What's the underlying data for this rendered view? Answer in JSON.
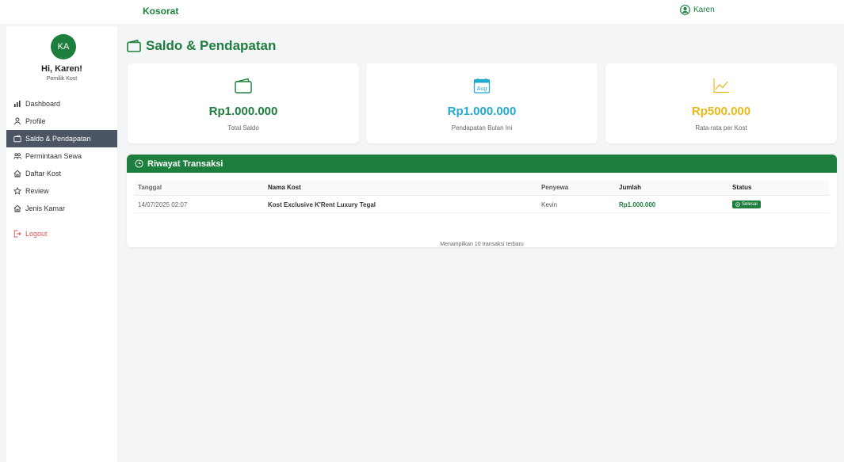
{
  "topbar": {
    "brand": "Kosorat",
    "user_name": "Karen"
  },
  "sidebar": {
    "avatar_initials": "KA",
    "greeting": "Hi, Karen!",
    "role": "Pemilik Kost",
    "items": [
      {
        "label": "Dashboard",
        "icon": "chart-icon"
      },
      {
        "label": "Profile",
        "icon": "person-icon"
      },
      {
        "label": "Saldo & Pendapatan",
        "icon": "wallet-icon",
        "active": true
      },
      {
        "label": "Permintaan Sewa",
        "icon": "people-icon"
      },
      {
        "label": "Daftar Kost",
        "icon": "house-icon"
      },
      {
        "label": "Review",
        "icon": "star-icon"
      },
      {
        "label": "Jenis Kamar",
        "icon": "house-icon"
      }
    ],
    "logout_label": "Logout"
  },
  "main": {
    "title": "Saldo & Pendapatan",
    "cards": [
      {
        "value": "Rp1.000.000",
        "caption": "Total Saldo",
        "icon": "wallet-icon",
        "color": "#1e7e3e"
      },
      {
        "value": "Rp1.000.000",
        "caption": "Pendapatan Bulan Ini",
        "icon": "calendar-icon",
        "icon_text": "Aug",
        "color": "#22aacc"
      },
      {
        "value": "Rp500.000",
        "caption": "Rata-rata per Kost",
        "icon": "trend-icon",
        "color": "#e8b81a"
      }
    ],
    "transactions": {
      "title": "Riwayat Transaksi",
      "columns": [
        "Tanggal",
        "Nama Kost",
        "Penyewa",
        "Jumlah",
        "Status"
      ],
      "rows": [
        {
          "date": "14/07/2025 02:07",
          "kost": "Kost Exclusive K'Rent Luxury Tegal",
          "tenant": "Kevin",
          "amount": "Rp1.000.000",
          "status": "Selesai"
        }
      ],
      "footnote": "Menampilkan 10 transaksi terbaru"
    }
  }
}
